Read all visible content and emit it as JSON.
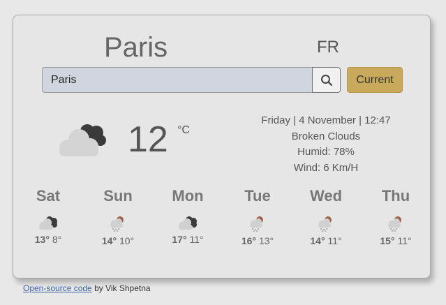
{
  "weather": {
    "city": "Paris",
    "country": "FR",
    "search": {
      "value": "Paris",
      "placeholder": ""
    },
    "current_button": "Current",
    "temperature": "12",
    "unit": "°C",
    "date": "Friday | 4 November | 12:47",
    "description": "Broken Clouds",
    "humidity": "Humid: 78%",
    "wind": "Wind: 6 Km/H",
    "main_icon": "broken-clouds-icon"
  },
  "forecast": [
    {
      "day": "Sat",
      "max": "13°",
      "min": "8°",
      "icon": "broken-clouds-icon"
    },
    {
      "day": "Sun",
      "max": "14°",
      "min": "10°",
      "icon": "rain-icon"
    },
    {
      "day": "Mon",
      "max": "17°",
      "min": "11°",
      "icon": "broken-clouds-icon"
    },
    {
      "day": "Tue",
      "max": "16°",
      "min": "13°",
      "icon": "rain-icon"
    },
    {
      "day": "Wed",
      "max": "14°",
      "min": "11°",
      "icon": "rain-icon"
    },
    {
      "day": "Thu",
      "max": "15°",
      "min": "11°",
      "icon": "rain-icon"
    }
  ],
  "footer": {
    "link": "Open-source code",
    "text": " by Vik Shpetna"
  }
}
